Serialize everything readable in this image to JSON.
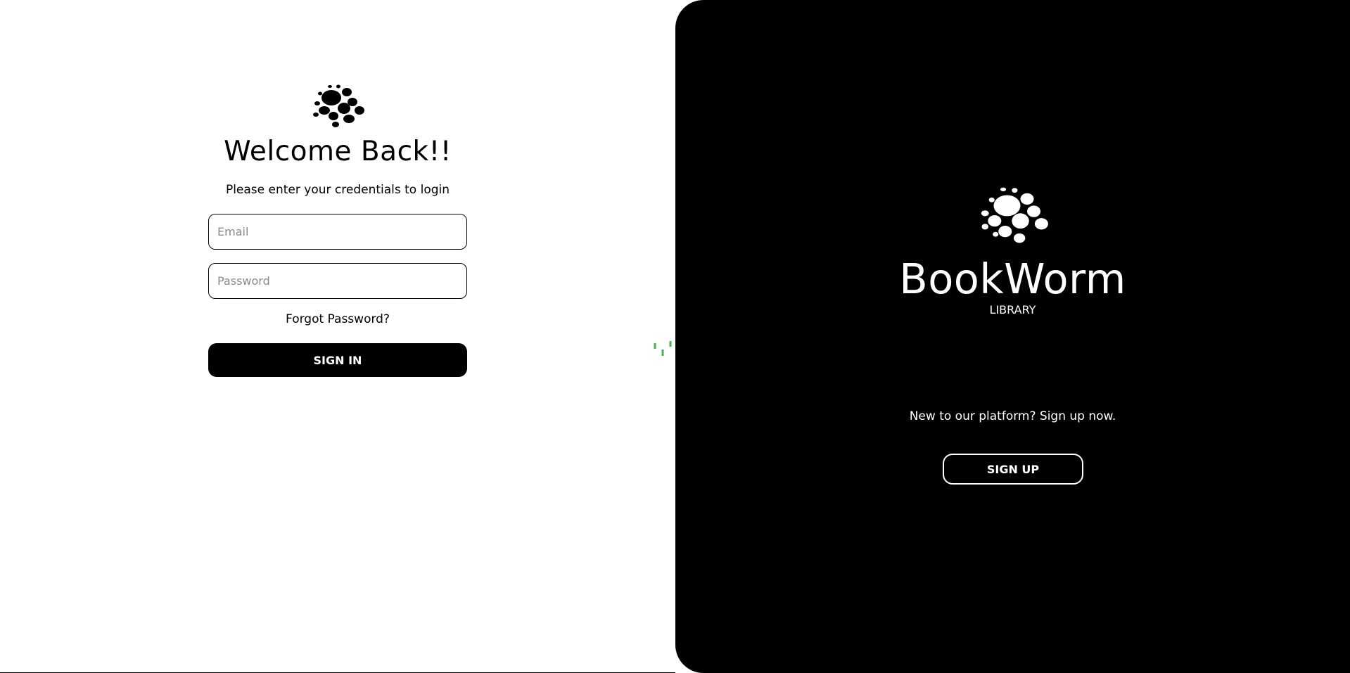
{
  "login": {
    "title": "Welcome Back!!",
    "subtitle": "Please enter your credentials to login",
    "email_placeholder": "Email",
    "password_placeholder": "Password",
    "forgot_label": "Forgot Password?",
    "signin_label": "SIGN IN"
  },
  "brand": {
    "name": "BookWorm",
    "sub": "LIBRARY",
    "signup_prompt": "New to our platform? Sign up now.",
    "signup_label": "SIGN UP"
  },
  "icons": {
    "logo": "bookworm-logo-icon",
    "spinner": "loading-spinner-icon"
  },
  "colors": {
    "panel_bg": "#000000",
    "page_bg": "#ffffff",
    "spinner": "#4caf50"
  }
}
